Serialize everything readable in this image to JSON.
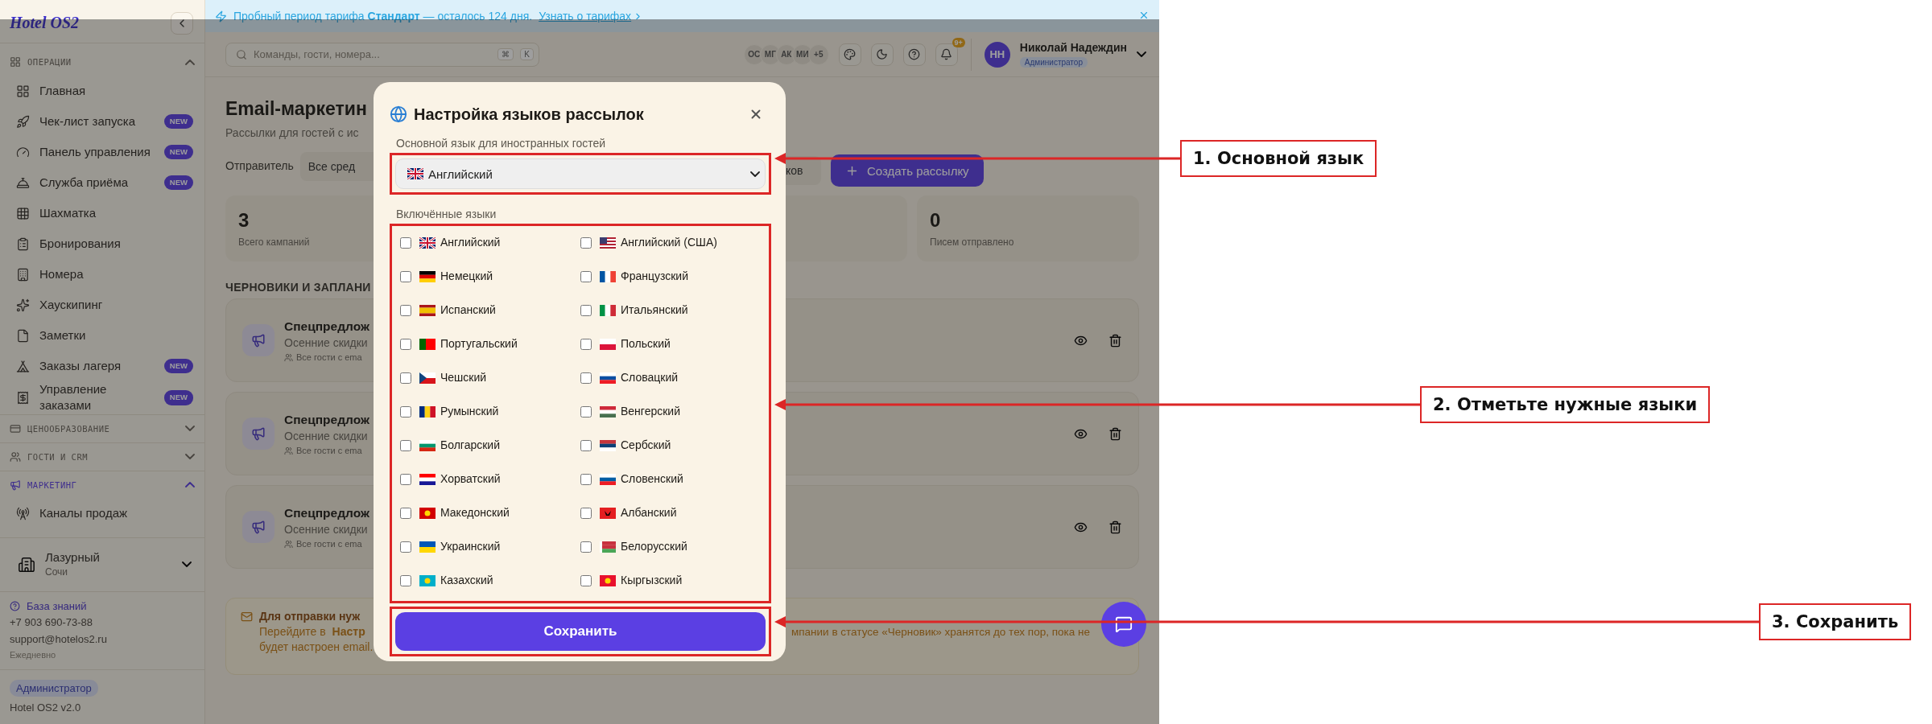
{
  "banner": {
    "text": "Пробный период тарифа **Стандарт** — осталось 124 дня.",
    "link": "Узнать о тарифах"
  },
  "sidebar": {
    "logo": "Hotel OS2",
    "sections": [
      {
        "title": "ОПЕРАЦИИ",
        "expanded": true,
        "active": false,
        "items": [
          {
            "label": "Главная"
          },
          {
            "label": "Чек-лист запуска",
            "badge": "NEW"
          },
          {
            "label": "Панель управления",
            "badge": "NEW"
          },
          {
            "label": "Служба приёма",
            "badge": "NEW"
          },
          {
            "label": "Шахматка"
          },
          {
            "label": "Бронирования"
          },
          {
            "label": "Номера"
          },
          {
            "label": "Хаускипинг"
          },
          {
            "label": "Заметки"
          },
          {
            "label": "Заказы лагеря",
            "badge": "NEW"
          },
          {
            "label": "Управление заказами",
            "badge": "NEW"
          }
        ]
      },
      {
        "title": "ЦЕНООБРАЗОВАНИЕ",
        "expanded": false,
        "active": false
      },
      {
        "title": "ГОСТИ И CRM",
        "expanded": false,
        "active": false
      },
      {
        "title": "МАРКЕТИНГ",
        "expanded": true,
        "active": true,
        "items": [
          {
            "label": "Каналы продаж"
          }
        ]
      }
    ],
    "hotel": {
      "name": "Лазурный",
      "city": "Сочи"
    },
    "help_link": "База знаний",
    "phone": "+7 903 690-73-88",
    "email": "support@hotelos2.ru",
    "hours": "Ежедневно",
    "role": "Администратор",
    "version": "Hotel OS2 v2.0"
  },
  "header": {
    "search_placeholder": "Команды, гости, номера...",
    "shortcut": [
      "⌘",
      "K"
    ],
    "avatars": [
      "ОС",
      "МГ",
      "АК",
      "МИ"
    ],
    "more": "+5",
    "notifications": "9+",
    "user": {
      "initials": "НН",
      "name": "Николай Надеждин",
      "role": "Администратор"
    }
  },
  "page": {
    "title": "Email-маркетин",
    "subtitle": "Рассылки для гостей с ис",
    "sender_label": "Отправитель",
    "sender_value": "Все сред",
    "filter_value": "ков",
    "create_button": "Создать рассылку",
    "stats": [
      {
        "value": "3",
        "label": "Всего кампаний"
      },
      {
        "value": "0",
        "label": "Писем отправлено"
      }
    ],
    "section_title": "ЧЕРНОВИКИ И ЗАПЛАНИ",
    "campaigns": [
      {
        "title": "Спецпредлож",
        "subtitle": "Осенние скидки",
        "audience": "Все гости с ema"
      },
      {
        "title": "Спецпредлож",
        "subtitle": "Осенние скидки",
        "audience": "Все гости с ema"
      },
      {
        "title": "Спецпредлож",
        "subtitle": "Осенние скидки",
        "audience": "Все гости с ema"
      }
    ],
    "notice": {
      "title": "Для отправки нуж",
      "line": "Перейдите в **Настр**",
      "right": "мпании в статусе «Черновик» хранятся до тех пор, пока не",
      "last": "будет настроен email."
    }
  },
  "modal": {
    "title": "Настройка языков рассылок",
    "primary_label": "Основной язык для иностранных гостей",
    "primary_value": "Английский",
    "enabled_label": "Включённые языки",
    "languages": [
      {
        "label": "Английский",
        "checked": false
      },
      {
        "label": "Английский (США)",
        "checked": false
      },
      {
        "label": "Немецкий",
        "checked": false
      },
      {
        "label": "Французский",
        "checked": false
      },
      {
        "label": "Испанский",
        "checked": false
      },
      {
        "label": "Итальянский",
        "checked": false
      },
      {
        "label": "Португальский",
        "checked": false
      },
      {
        "label": "Польский",
        "checked": false
      },
      {
        "label": "Чешский",
        "checked": false
      },
      {
        "label": "Словацкий",
        "checked": false
      },
      {
        "label": "Румынский",
        "checked": false
      },
      {
        "label": "Венгерский",
        "checked": false
      },
      {
        "label": "Болгарский",
        "checked": false
      },
      {
        "label": "Сербский",
        "checked": false
      },
      {
        "label": "Хорватский",
        "checked": false
      },
      {
        "label": "Словенский",
        "checked": false
      },
      {
        "label": "Македонский",
        "checked": false
      },
      {
        "label": "Албанский",
        "checked": false
      },
      {
        "label": "Украинский",
        "checked": false
      },
      {
        "label": "Белорусский",
        "checked": false
      },
      {
        "label": "Казахский",
        "checked": false
      },
      {
        "label": "Кыргызский",
        "checked": false
      }
    ],
    "save": "Сохранить"
  },
  "annotations": [
    {
      "label": "1. Основной язык"
    },
    {
      "label": "2. Отметьте нужные языки"
    },
    {
      "label": "3. Сохранить"
    }
  ]
}
